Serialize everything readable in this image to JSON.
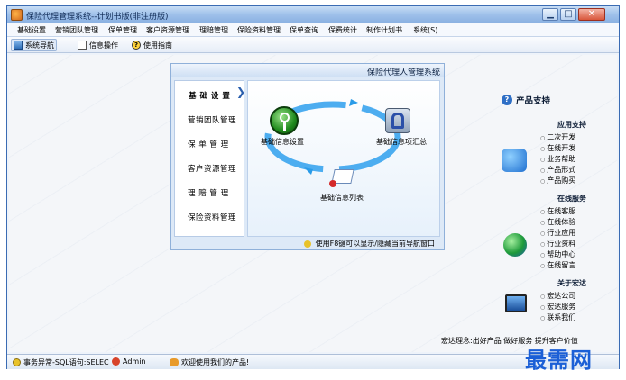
{
  "window": {
    "title": "保险代理管理系统--计划书版(非注册版)",
    "controls": {
      "minimize": "▁",
      "maximize": "□",
      "close": "✕"
    }
  },
  "menu": [
    "基础设置",
    "营销团队管理",
    "保单管理",
    "客户资源管理",
    "理赔管理",
    "保险资料管理",
    "保单查询",
    "保费统计",
    "制作计划书",
    "系统(S)"
  ],
  "toolbar": {
    "nav_label": "系统导航",
    "info_label": "信息操作",
    "help_label": "使用指南"
  },
  "nav_panel": {
    "title": "保险代理人管理系统",
    "items": [
      "基 础 设 置",
      "营销团队管理",
      "保 单 管 理",
      "客户资源管理",
      "理 赔 管 理",
      "保险资料管理"
    ],
    "diagram": {
      "node_settings": "基础信息设置",
      "node_summary": "基础信息项汇总",
      "node_list": "基础信息列表"
    },
    "footer": "使用F8键可以显示/隐藏当前导航窗口"
  },
  "support": {
    "title": "产品支持",
    "sections": [
      {
        "title": "应用支持",
        "links": [
          "二次开发",
          "在线开发",
          "业务帮助",
          "产品形式",
          "产品购买"
        ]
      },
      {
        "title": "在线服务",
        "links": [
          "在线客服",
          "在线体验",
          "行业应用",
          "行业资料",
          "帮助中心",
          "在线留言"
        ]
      },
      {
        "title": "关于宏达",
        "links": [
          "宏达公司",
          "宏达服务",
          "联系我们"
        ]
      }
    ],
    "slogan": "宏达理念:出好产品 做好服务 提升客户价值"
  },
  "status": {
    "sql": "事务异常-SQL语句:SELEC",
    "user": "Admin",
    "welcome": "欢迎使用我们的产品!"
  },
  "watermark": "最需网",
  "colors": {
    "accent": "#2e86de",
    "title_bar": "#9fc1ea",
    "arrow_blue": "#2a9be8"
  }
}
